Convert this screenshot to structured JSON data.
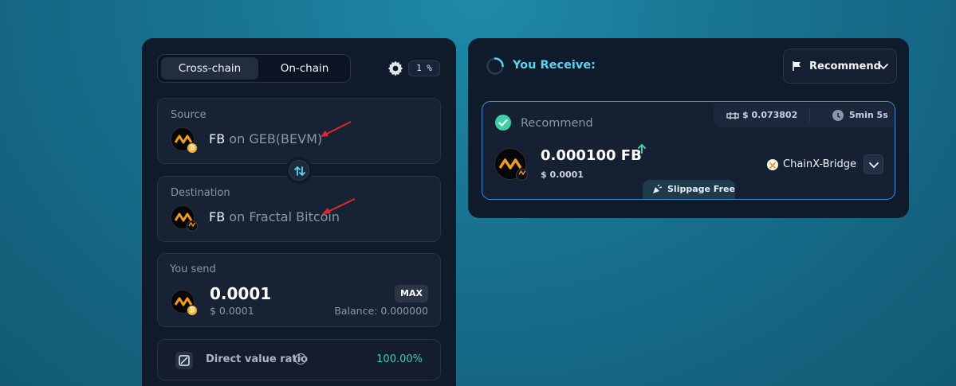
{
  "tabs": {
    "cross_chain": "Cross-chain",
    "on_chain": "On-chain",
    "active": "Cross-chain"
  },
  "settings": {
    "slippage_label": "1 %",
    "icon": "gear-icon"
  },
  "source": {
    "label": "Source",
    "token": "FB",
    "connector": "on",
    "chain": "GEB(BEVM)",
    "badge_icon": "bitcoin-icon"
  },
  "destination": {
    "label": "Destination",
    "token": "FB",
    "connector": "on",
    "chain": "Fractal Bitcoin",
    "badge_icon": "fractal-icon"
  },
  "swap_icon": "swap-arrows-icon",
  "send": {
    "label": "You send",
    "amount": "0.0001",
    "usd": "$ 0.0001",
    "max_label": "MAX",
    "balance": "Balance: 0.000000"
  },
  "ratio": {
    "label": "Direct value ratio",
    "info": "i",
    "value": "100.00%"
  },
  "receive": {
    "title": "You Receive:",
    "sort_label": "Recommend",
    "route": {
      "title": "Recommend",
      "gas": "$ 0.073802",
      "time": "5min 5s",
      "amount": "0.000100 FB",
      "usd": "$ 0.0001",
      "bridge": "ChainX-Bridge",
      "tag": "Slippage Free"
    }
  },
  "colors": {
    "panel": "#0f1a2b",
    "card": "#172234",
    "accent_cyan": "#58d4f3",
    "accent_green": "#3fcfa8",
    "route_border": "#3d8ed8",
    "annotation_red": "#e0282e",
    "fb_orange": "#f29a1d"
  }
}
